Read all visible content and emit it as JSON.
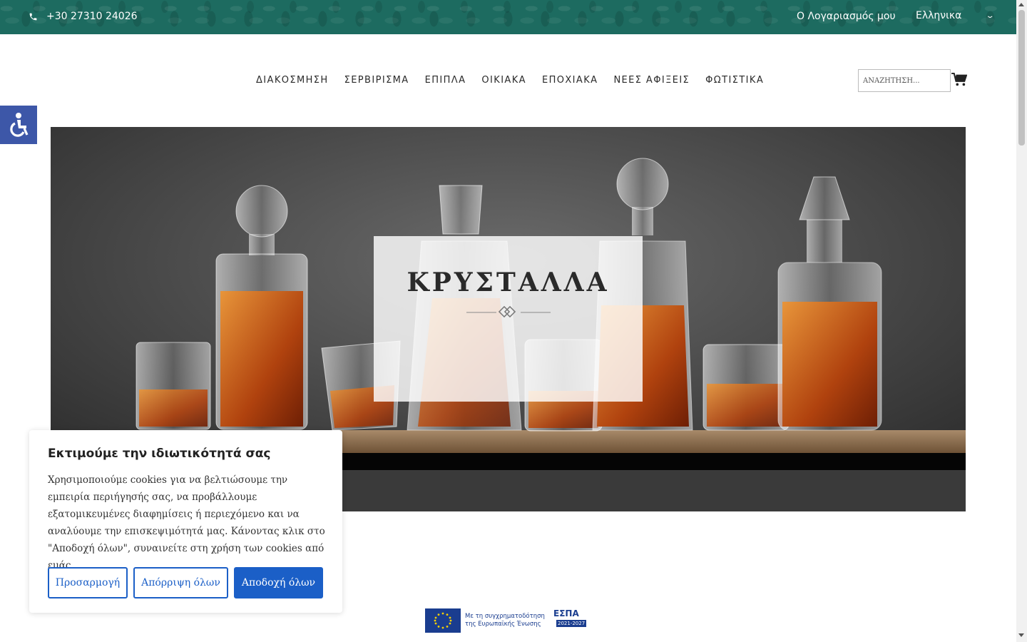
{
  "topbar": {
    "phone": "+30 27310 24026",
    "account": "Ο Λογαριασμός μου",
    "language": "Ελληνικα",
    "color": "#1d6b60"
  },
  "nav": {
    "items": [
      "ΔΙΑΚΟΣΜΗΣΗ",
      "ΣΕΡΒΙΡΙΣΜΑ",
      "ΕΠΙΠΛΑ",
      "ΟΙΚΙΑΚΑ",
      "ΕΠΟΧΙΑΚΑ",
      "ΝΕΕΣ ΑΦΙΞΕΙΣ",
      "ΦΩΤΙΣΤΙΚΑ"
    ]
  },
  "search": {
    "placeholder": "ΑΝΑΖΗΤΗΣΗ..."
  },
  "icons": {
    "phone": "phone-icon",
    "cart": "cart-icon",
    "accessibility": "accessibility-icon",
    "language_dropdown": "chevron-down-icon"
  },
  "hero": {
    "title": "ΚΡΥΣΤΑΛΛΑ"
  },
  "cookie": {
    "title": "Εκτιμούμε την ιδιωτικότητά σας",
    "text": "Χρησιμοποιούμε cookies για να βελτιώσουμε την εμπειρία περιήγησής σας, να προβάλλουμε εξατομικευμένες διαφημίσεις ή περιεχόμενο και να αναλύουμε την επισκεψιμότητά μας. Κάνοντας κλικ στο \"Αποδοχή όλων\", συναινείτε στη χρήση των cookies από εμάς.",
    "customize": "Προσαρμογή",
    "reject": "Απόρριψη όλων",
    "accept": "Αποδοχή όλων",
    "accent": "#1b5fc7"
  },
  "eu_banner": {
    "line1": "Με τη συγχρηματοδότηση",
    "line2": "της Ευρωπαϊκής Ένωσης",
    "espa": "ΕΣΠΑ",
    "years": "2021-2027"
  }
}
